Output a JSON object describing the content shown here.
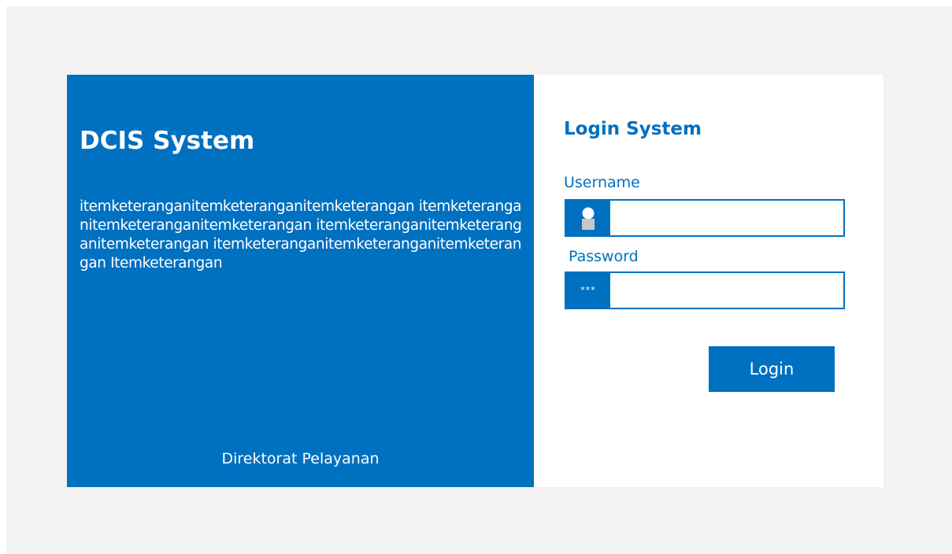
{
  "brand": {
    "title": "DCIS System",
    "description": "itemketeranganitemketeranganitemketerangan itemketeranganitemketeranganitemketerangan itemketeranganitemketeranganitemketerangan itemketeranganitemketeranganitemketerangan Itemketerangan",
    "footer": "Direktorat Pelayanan"
  },
  "login": {
    "title": "Login System",
    "username_label": "Username",
    "username_value": "",
    "password_label": "Password",
    "password_value": "",
    "password_icon_text": "***",
    "submit_label": "Login"
  },
  "icons": {
    "username": "user-icon",
    "password": "password-icon"
  },
  "colors": {
    "accent": "#0070c0",
    "background": "#f2f2f2",
    "panel": "#ffffff"
  }
}
